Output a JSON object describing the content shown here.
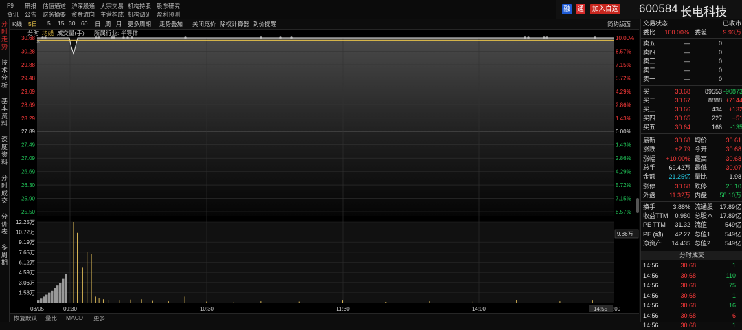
{
  "top_menu": {
    "row1": [
      "F9",
      "研报",
      "估值通道",
      "沪深股通",
      "大宗交易",
      "机构持股",
      "股东研究"
    ],
    "row2": [
      "资讯",
      "公告",
      "财务摘要",
      "资金流向",
      "主营构成",
      "机构调研",
      "盈利预测"
    ]
  },
  "header": {
    "tag_rong": "融",
    "tag_tong": "通",
    "add_watch": "加入自选",
    "code": "600584",
    "name": "长电科技"
  },
  "left_tabs": [
    {
      "label": "分时走势",
      "active": true
    },
    {
      "label": "技术分析",
      "active": false
    },
    {
      "label": "基本资料",
      "active": false
    },
    {
      "label": "深度资料",
      "active": false
    },
    {
      "label": "分时成交",
      "active": false
    },
    {
      "label": "分价表",
      "active": false
    },
    {
      "label": "多周期",
      "active": false
    }
  ],
  "toolbar": {
    "items": [
      "K线",
      "5日",
      "5",
      "15",
      "30",
      "60",
      "日",
      "周",
      "月",
      "更多周期",
      "走势叠加",
      "关闭竞价",
      "除权计算器",
      "到价提醒"
    ],
    "selected": "5日",
    "right": "简约版面"
  },
  "subbar": {
    "fen_shi": "分时",
    "jun_xian": "均线",
    "volume": "成交量(手)",
    "industry": "所属行业: 半导体"
  },
  "chart_data": {
    "type": "line",
    "price_ticks": [
      "30.68",
      "30.28",
      "29.88",
      "29.48",
      "29.09",
      "28.69",
      "28.29",
      "27.89",
      "27.49",
      "27.09",
      "26.69",
      "26.30",
      "25.90",
      "25.50"
    ],
    "pct_ticks": [
      "10.00%",
      "8.57%",
      "7.15%",
      "5.72%",
      "4.29%",
      "2.86%",
      "1.43%",
      "0.00%",
      "1.43%",
      "2.86%",
      "4.29%",
      "5.72%",
      "7.15%",
      "8.57%"
    ],
    "vol_ticks": [
      "12.25万",
      "10.72万",
      "9.19万",
      "7.65万",
      "6.12万",
      "4.59万",
      "3.06万",
      "1.53万"
    ],
    "vol_marker": "9.86万",
    "time_labels": [
      "03/05",
      "09:30",
      "10:30",
      "11:30",
      "14:00",
      "14:55"
    ],
    "time_end_partial": ":00",
    "prev_close": 27.89,
    "limit_up": 30.68,
    "price_series": {
      "name": "价格",
      "start": 30.68,
      "dip_low": 30.2,
      "end": 30.68
    },
    "avg_series": {
      "name": "均价",
      "value": 30.61
    },
    "volume_bars": [
      {
        "t": 0.005,
        "v": 12.25
      },
      {
        "t": 0.012,
        "v": 10.6
      },
      {
        "t": 0.022,
        "v": 5.3
      },
      {
        "t": 0.03,
        "v": 7.65
      },
      {
        "t": 0.038,
        "v": 7.4
      },
      {
        "t": 0.046,
        "v": 0.9
      },
      {
        "t": 0.052,
        "v": 0.7
      },
      {
        "t": 0.06,
        "v": 0.5
      },
      {
        "t": 0.07,
        "v": 0.4
      },
      {
        "t": 0.09,
        "v": 0.3
      },
      {
        "t": 0.11,
        "v": 0.45
      },
      {
        "t": 0.13,
        "v": 0.5
      },
      {
        "t": 0.15,
        "v": 0.25
      },
      {
        "t": 0.18,
        "v": 0.2
      },
      {
        "t": 0.21,
        "v": 0.9
      },
      {
        "t": 0.25,
        "v": 0.15
      },
      {
        "t": 0.3,
        "v": 0.1
      },
      {
        "t": 0.35,
        "v": 0.2
      },
      {
        "t": 0.42,
        "v": 0.15
      },
      {
        "t": 0.5,
        "v": 0.3
      },
      {
        "t": 0.58,
        "v": 0.1
      },
      {
        "t": 0.66,
        "v": 0.2
      },
      {
        "t": 0.74,
        "v": 0.15
      },
      {
        "t": 0.82,
        "v": 0.4
      },
      {
        "t": 0.9,
        "v": 0.2
      },
      {
        "t": 0.96,
        "v": 0.3
      }
    ],
    "prev_day_volume_spike": [
      0.3,
      0.6,
      0.9,
      1.2,
      1.5,
      1.8,
      2.2,
      2.6,
      3.0,
      3.6,
      4.4
    ]
  },
  "bottom_bar": [
    "恢复默认",
    "量比",
    "MACD",
    "更多"
  ],
  "right_panel": {
    "status_label": "交易状态",
    "status_value": "已收市",
    "weibi_label": "委比",
    "weibi_value": "100.00%",
    "weicha_label": "委差",
    "weicha_value": "9.93万",
    "sell": [
      {
        "label": "卖五",
        "price": "—",
        "vol": "0"
      },
      {
        "label": "卖四",
        "price": "—",
        "vol": "0"
      },
      {
        "label": "卖三",
        "price": "—",
        "vol": "0"
      },
      {
        "label": "卖二",
        "price": "—",
        "vol": "0"
      },
      {
        "label": "卖一",
        "price": "—",
        "vol": "0"
      }
    ],
    "buy": [
      {
        "label": "买一",
        "price": "30.68",
        "vol": "89553",
        "chg": "-90873"
      },
      {
        "label": "买二",
        "price": "30.67",
        "vol": "8888",
        "chg": "+7144"
      },
      {
        "label": "买三",
        "price": "30.66",
        "vol": "434",
        "chg": "+132"
      },
      {
        "label": "买四",
        "price": "30.65",
        "vol": "227",
        "chg": "+51"
      },
      {
        "label": "买五",
        "price": "30.64",
        "vol": "166",
        "chg": "-135"
      }
    ],
    "stats": [
      {
        "l1": "最新",
        "v1": "30.68",
        "c1": "red",
        "l2": "均价",
        "v2": "30.61",
        "c2": "red"
      },
      {
        "l1": "涨跌",
        "v1": "+2.79",
        "c1": "red",
        "l2": "今开",
        "v2": "30.68",
        "c2": "red"
      },
      {
        "l1": "涨幅",
        "v1": "+10.00%",
        "c1": "red",
        "l2": "最高",
        "v2": "30.68",
        "c2": "red"
      },
      {
        "l1": "总手",
        "v1": "69.42万",
        "c1": "wht",
        "l2": "最低",
        "v2": "30.07",
        "c2": "red"
      },
      {
        "l1": "金额",
        "v1": "21.25亿",
        "c1": "cyan",
        "l2": "量比",
        "v2": "1.98",
        "c2": "wht"
      },
      {
        "l1": "涨停",
        "v1": "30.68",
        "c1": "red",
        "l2": "跌停",
        "v2": "25.10",
        "c2": "grn"
      },
      {
        "l1": "外盘",
        "v1": "11.32万",
        "c1": "red",
        "l2": "内盘",
        "v2": "58.10万",
        "c2": "grn"
      }
    ],
    "fin": [
      {
        "l1": "换手",
        "v1": "3.88%",
        "l2": "流通股",
        "v2": "17.89亿"
      },
      {
        "l1": "收益TTM",
        "v1": "0.980",
        "l2": "总股本",
        "v2": "17.89亿"
      },
      {
        "l1": "PE TTM",
        "v1": "31.32",
        "l2": "流值",
        "v2": "549亿"
      },
      {
        "l1": "PE (动)",
        "v1": "42.27",
        "l2": "总值1",
        "v2": "549亿"
      },
      {
        "l1": "净资产",
        "v1": "14.435",
        "l2": "总值2",
        "v2": "549亿"
      }
    ],
    "ticks_title": "分时成交",
    "ticks": [
      {
        "time": "14:56",
        "price": "30.68",
        "vol": "1"
      },
      {
        "time": "14:56",
        "price": "30.68",
        "vol": "110"
      },
      {
        "time": "14:56",
        "price": "30.68",
        "vol": "75"
      },
      {
        "time": "14:56",
        "price": "30.68",
        "vol": "1"
      },
      {
        "time": "14:56",
        "price": "30.68",
        "vol": "16"
      },
      {
        "time": "14:56",
        "price": "30.68",
        "vol": "6"
      },
      {
        "time": "14:56",
        "price": "30.68",
        "vol": "1"
      }
    ]
  }
}
